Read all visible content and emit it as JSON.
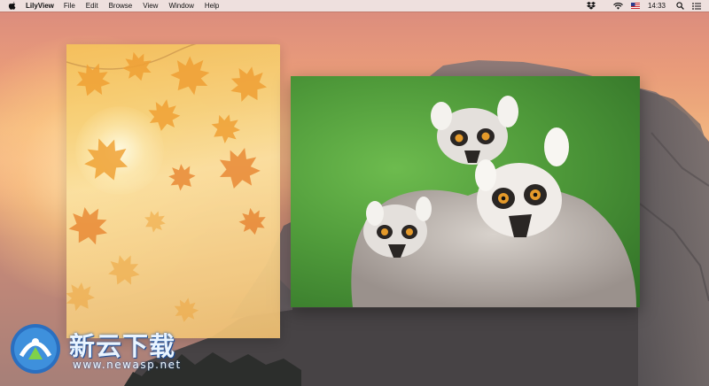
{
  "menubar": {
    "app_name": "LilyView",
    "menus": [
      "File",
      "Edit",
      "Browse",
      "View",
      "Window",
      "Help"
    ],
    "clock": "14:33",
    "status_icons": [
      "dropbox-icon",
      "wifi-icon",
      "flag-icon",
      "search-icon",
      "list-icon"
    ]
  },
  "windows": [
    {
      "name": "autumn-leaves-image",
      "subject": "autumn leaves"
    },
    {
      "name": "lemurs-image",
      "subject": "ring-tailed lemurs"
    }
  ],
  "watermark": {
    "brand": "新云下载",
    "url": "www.newasp.net"
  },
  "colors": {
    "menubar_bg": "#f0ecec",
    "lemur_bg_green": "#4f9a3a",
    "autumn_yellow": "#f7d27a",
    "watermark_blue": "#2a6fc0"
  }
}
